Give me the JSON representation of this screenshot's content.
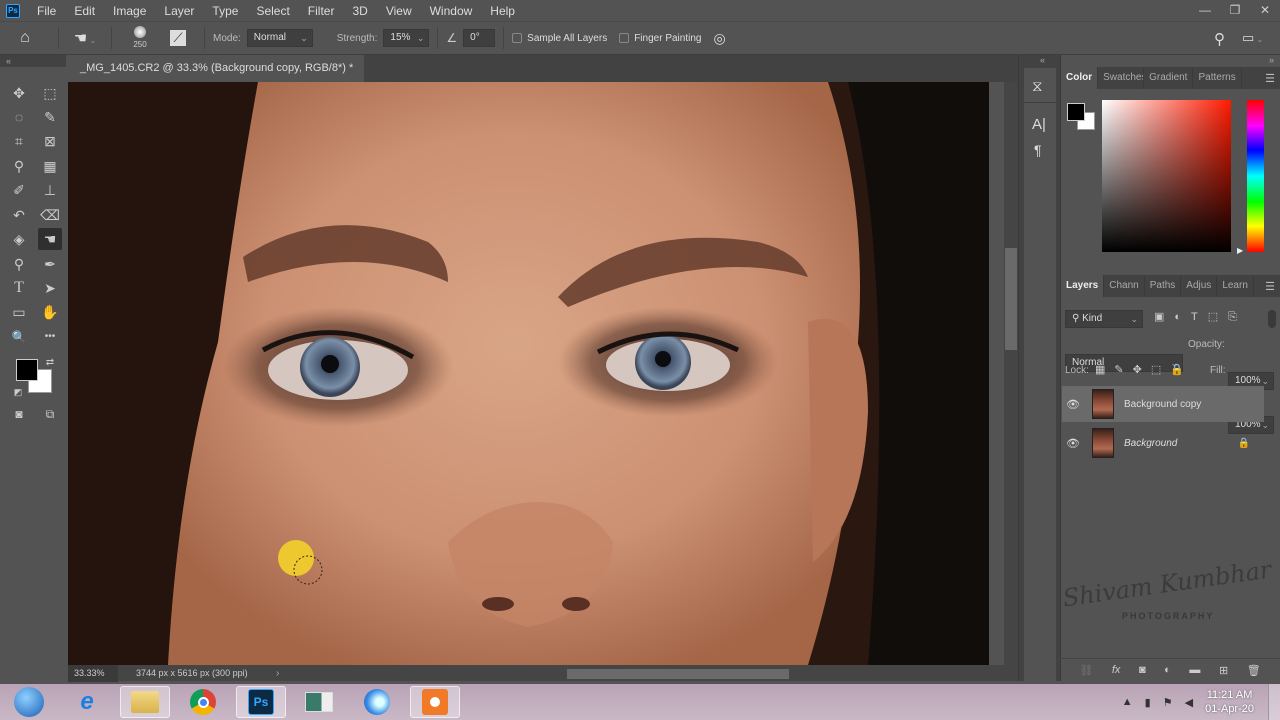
{
  "app": {
    "name": "Photoshop",
    "logo_text": "Ps"
  },
  "menu": [
    "File",
    "Edit",
    "Image",
    "Layer",
    "Type",
    "Select",
    "Filter",
    "3D",
    "View",
    "Window",
    "Help"
  ],
  "window_controls": {
    "minimize": "—",
    "restore": "❐",
    "close": "✕"
  },
  "options_bar": {
    "brush_size": "250",
    "mode_label": "Mode:",
    "mode_value": "Normal",
    "strength_label": "Strength:",
    "strength_value": "15%",
    "angle_value": "0°",
    "sample_all_layers_label": "Sample All Layers",
    "sample_all_layers_checked": false,
    "finger_painting_label": "Finger Painting",
    "finger_painting_checked": false
  },
  "document_tab": {
    "title": "_MG_1405.CR2 @ 33.3% (Background copy, RGB/8*) *",
    "close": "×"
  },
  "collapse_left": "«",
  "collapse_right": "»",
  "tools": [
    {
      "name": "move-tool",
      "glyph": "✥"
    },
    {
      "name": "rect-marquee-tool",
      "glyph": "⬚"
    },
    {
      "name": "lasso-tool",
      "glyph": "◌"
    },
    {
      "name": "quick-selection-tool",
      "glyph": "✎"
    },
    {
      "name": "crop-tool",
      "glyph": "⌗"
    },
    {
      "name": "frame-tool",
      "glyph": "⊠"
    },
    {
      "name": "eyedropper-tool",
      "glyph": "⚲"
    },
    {
      "name": "patch-tool",
      "glyph": "▦"
    },
    {
      "name": "brush-tool",
      "glyph": "✐"
    },
    {
      "name": "clone-stamp-tool",
      "glyph": "⊥"
    },
    {
      "name": "history-brush-tool",
      "glyph": "↶"
    },
    {
      "name": "eraser-tool",
      "glyph": "⌫"
    },
    {
      "name": "paint-bucket-tool",
      "glyph": "◈"
    },
    {
      "name": "smudge-tool",
      "glyph": "☚"
    },
    {
      "name": "dodge-tool",
      "glyph": "⚲"
    },
    {
      "name": "pen-tool",
      "glyph": "✒"
    },
    {
      "name": "type-tool",
      "glyph": "T"
    },
    {
      "name": "path-selection-tool",
      "glyph": "➤"
    },
    {
      "name": "rectangle-tool",
      "glyph": "▭"
    },
    {
      "name": "hand-tool",
      "glyph": "✋"
    },
    {
      "name": "zoom-tool",
      "glyph": "🔍"
    },
    {
      "name": "edit-toolbar",
      "glyph": "•••"
    }
  ],
  "colors": {
    "foreground": "#000000",
    "background": "#ffffff",
    "accent": "#31a8ff",
    "panel": "#535353"
  },
  "status_bar": {
    "zoom": "33.33%",
    "doc_info": "3744 px x 5616 px (300 ppi)",
    "arrow": "›"
  },
  "color_panel": {
    "tabs": [
      "Color",
      "Swatches",
      "Gradient",
      "Patterns"
    ],
    "active": "Color"
  },
  "layers_panel": {
    "tabs": [
      "Layers",
      "Channels",
      "Paths",
      "Adjustments",
      "Learn"
    ],
    "tab_labels": [
      "Layers",
      "Chann",
      "Paths",
      "Adjus",
      "Learn"
    ],
    "active": "Layers",
    "filter_kind": "Kind",
    "blend_mode": "Normal",
    "opacity_label": "Opacity:",
    "opacity_value": "100%",
    "lock_label": "Lock:",
    "fill_label": "Fill:",
    "fill_value": "100%",
    "layers": [
      {
        "name": "Background copy",
        "visible": true,
        "selected": true,
        "locked": false
      },
      {
        "name": "Background",
        "visible": true,
        "selected": false,
        "locked": true
      }
    ]
  },
  "watermark": {
    "script": "Shivam Kumbhar",
    "subtitle": "PHOTOGRAPHY"
  },
  "taskbar": {
    "apps": [
      "start",
      "internet-explorer",
      "file-explorer",
      "chrome",
      "photoshop",
      "media-app",
      "browser-app",
      "screen-recorder"
    ],
    "clock_time": "11:21 AM",
    "clock_date": "01-Apr-20"
  }
}
